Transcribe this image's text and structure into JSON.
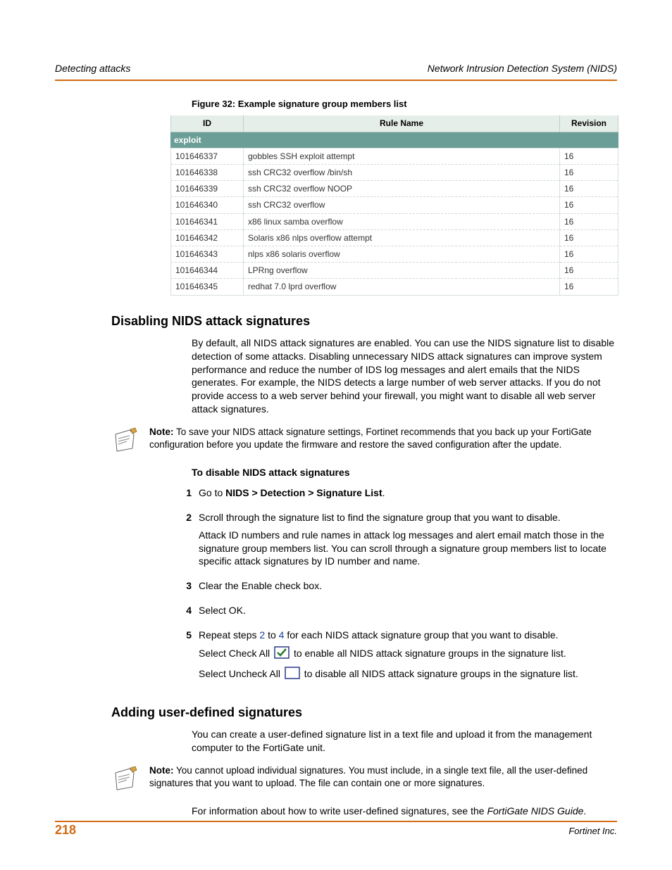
{
  "running_head": {
    "left": "Detecting attacks",
    "right": "Network Intrusion Detection System (NIDS)"
  },
  "figure_caption": "Figure 32: Example signature group members list",
  "table": {
    "group_title": "exploit",
    "headers": {
      "id": "ID",
      "rule": "Rule Name",
      "rev": "Revision"
    },
    "rows": [
      {
        "id": "101646337",
        "rule": "gobbles SSH exploit attempt",
        "rev": "16"
      },
      {
        "id": "101646338",
        "rule": "ssh CRC32 overflow /bin/sh",
        "rev": "16"
      },
      {
        "id": "101646339",
        "rule": "ssh CRC32 overflow NOOP",
        "rev": "16"
      },
      {
        "id": "101646340",
        "rule": "ssh CRC32 overflow",
        "rev": "16"
      },
      {
        "id": "101646341",
        "rule": "x86 linux samba overflow",
        "rev": "16"
      },
      {
        "id": "101646342",
        "rule": "Solaris x86 nlps overflow attempt",
        "rev": "16"
      },
      {
        "id": "101646343",
        "rule": "nlps x86 solaris overflow",
        "rev": "16"
      },
      {
        "id": "101646344",
        "rule": "LPRng overflow",
        "rev": "16"
      },
      {
        "id": "101646345",
        "rule": "redhat 7.0 lprd overflow",
        "rev": "16"
      }
    ]
  },
  "section1": {
    "heading": "Disabling NIDS attack signatures",
    "para": "By default, all NIDS attack signatures are enabled. You can use the NIDS signature list to disable detection of some attacks. Disabling unnecessary NIDS attack signatures can improve system performance and reduce the number of IDS log messages and alert emails that the NIDS generates. For example, the NIDS detects a large number of web server attacks. If you do not provide access to a web server behind your firewall, you might want to disable all web server attack signatures.",
    "note_label": "Note:",
    "note_text": " To save your NIDS attack signature settings, Fortinet recommends that you back up your FortiGate configuration before you update the firmware and restore the saved configuration after the update.",
    "subhead": "To disable NIDS attack signatures",
    "steps": {
      "s1_pre": "Go to ",
      "s1_bold": "NIDS > Detection > Signature List",
      "s1_post": ".",
      "s2_a": "Scroll through the signature list to find the signature group that you want to disable.",
      "s2_b": "Attack ID numbers and rule names in attack log messages and alert email match those in the signature group members list. You can scroll through a signature group members list to locate specific attack signatures by ID number and name.",
      "s3": "Clear the Enable check box.",
      "s4": "Select OK.",
      "s5_a_pre": "Repeat steps ",
      "s5_a_link1": "2",
      "s5_a_mid": " to ",
      "s5_a_link2": "4",
      "s5_a_post": " for each NIDS attack signature group that you want to disable.",
      "s5_b": "Select Check All ",
      "s5_b_post": " to enable all NIDS attack signature groups in the signature list.",
      "s5_c": "Select Uncheck All ",
      "s5_c_post": " to disable all NIDS attack signature groups in the signature list."
    }
  },
  "section2": {
    "heading": "Adding user-defined signatures",
    "para": "You can create a user-defined signature list in a text file and upload it from the management computer to the FortiGate unit.",
    "note_label": "Note:",
    "note_text": " You cannot upload individual signatures. You must include, in a single text file, all the user-defined signatures that you want to upload. The file can contain one or more signatures.",
    "para2_pre": "For information about how to write user-defined signatures, see the ",
    "para2_ital": "FortiGate NIDS Guide",
    "para2_post": "."
  },
  "footer": {
    "page": "218",
    "right": "Fortinet Inc."
  }
}
